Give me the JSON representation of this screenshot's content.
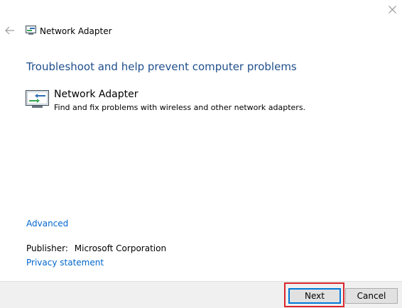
{
  "window": {
    "title": "Network Adapter",
    "close_icon": "close-icon",
    "back_icon": "back-arrow-icon"
  },
  "main": {
    "heading": "Troubleshoot and help prevent computer problems",
    "item": {
      "icon": "network-adapter-icon",
      "name": "Network Adapter",
      "description": "Find and fix problems with wireless and other network adapters."
    },
    "advanced_link": "Advanced",
    "publisher_label": "Publisher:",
    "publisher_value": "Microsoft Corporation",
    "privacy_link": "Privacy statement"
  },
  "footer": {
    "next_label": "Next",
    "cancel_label": "Cancel"
  },
  "colors": {
    "heading": "#1e4e8c",
    "link": "#0066cc",
    "focus_border": "#0078d7",
    "highlight": "#d9252a",
    "footer_bg": "#f0f0f0"
  }
}
